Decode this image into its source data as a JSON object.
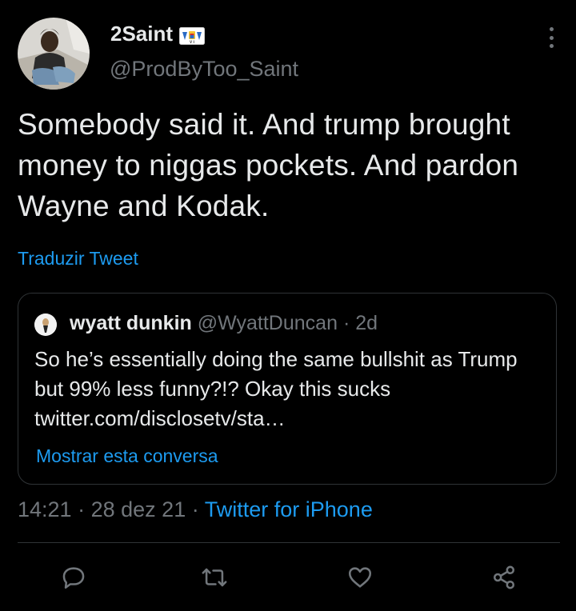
{
  "author": {
    "display_name": "2Saint",
    "handle": "@ProdByToo_Saint",
    "badge_icon": "virgin-islands-flag-icon",
    "avatar": "profile-photo"
  },
  "tweet": {
    "text": "Somebody said it. And trump brought money to niggas pockets. And pardon Wayne and Kodak.",
    "translate_label": "Traduzir Tweet"
  },
  "quoted": {
    "name": "wyatt dunkin",
    "handle": "@WyattDuncan",
    "separator": "·",
    "age": "2d",
    "text": "So he’s essentially doing the same bullshit as Trump but 99% less funny?!? Okay this sucks twitter.com/disclosetv/sta…",
    "show_thread_label": "Mostrar esta conversa"
  },
  "meta": {
    "time": "14:21",
    "sep1": "·",
    "date": "28 dez 21",
    "sep2": "·",
    "client": "Twitter for iPhone"
  },
  "actions": {
    "reply_icon": "reply-icon",
    "retweet_icon": "retweet-icon",
    "like_icon": "heart-icon",
    "share_icon": "share-icon"
  },
  "colors": {
    "background": "#000000",
    "text": "#e7e9ea",
    "secondary": "#71767b",
    "link": "#1d9bf0",
    "border": "#2f3336"
  }
}
